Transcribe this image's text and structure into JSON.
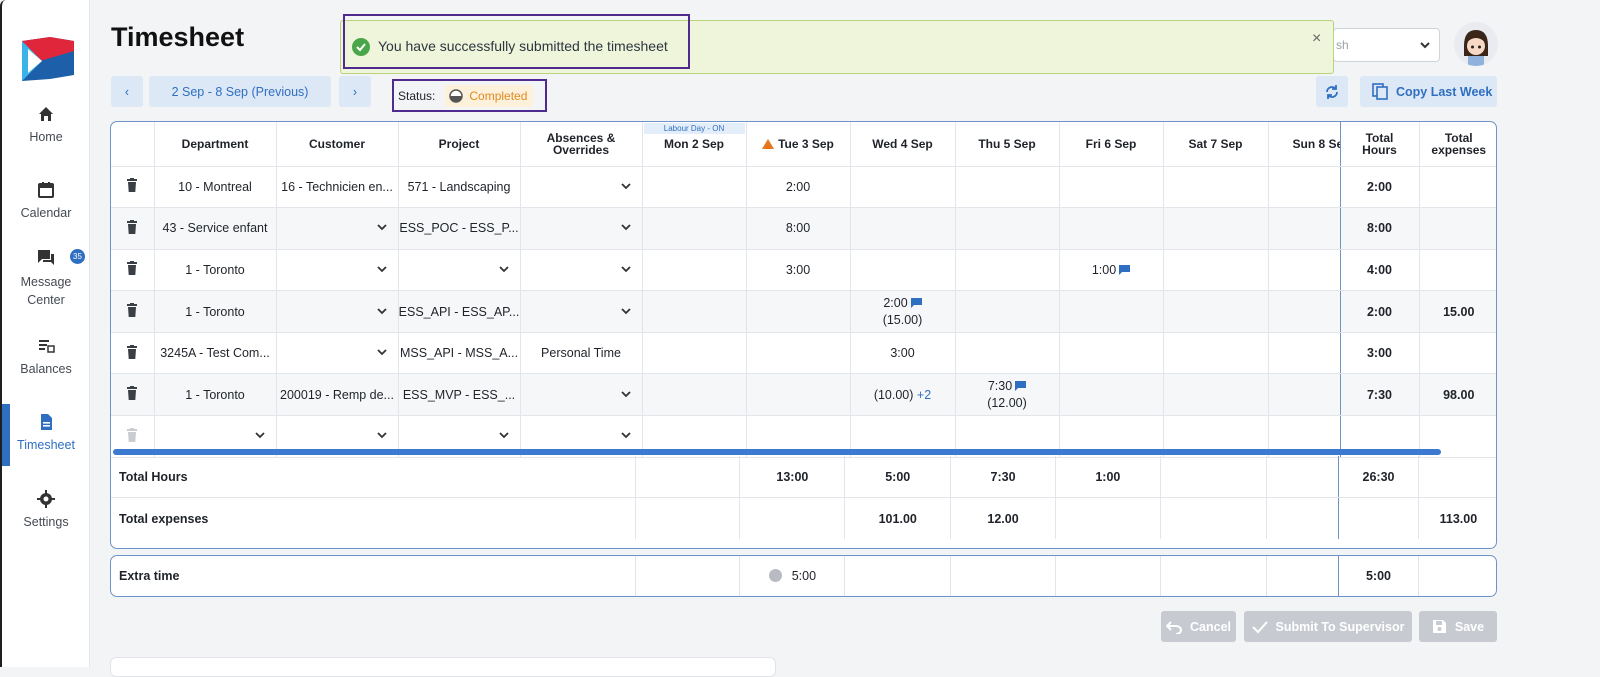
{
  "page": {
    "title": "Timesheet"
  },
  "toast": {
    "message": "You have successfully submitted the timesheet",
    "close": "×"
  },
  "header": {
    "language_placeholder": "sh"
  },
  "sidebar": {
    "items": [
      {
        "label": "Home",
        "icon": "home-icon"
      },
      {
        "label": "Calendar",
        "icon": "calendar-icon"
      },
      {
        "label": "Message Center",
        "icon": "message-icon",
        "badge": "35"
      },
      {
        "label": "Balances",
        "icon": "balances-icon"
      },
      {
        "label": "Timesheet",
        "icon": "timesheet-icon",
        "active": true
      },
      {
        "label": "Settings",
        "icon": "gear-icon"
      }
    ]
  },
  "week": {
    "range": "2 Sep - 8 Sep (Previous)",
    "prev": "‹",
    "next": "›"
  },
  "status": {
    "label": "Status:",
    "value": "Completed"
  },
  "toolbar": {
    "copy_label": "Copy Last Week"
  },
  "columns": {
    "department": "Department",
    "customer": "Customer",
    "project": "Project",
    "absences": "Absences & Overrides",
    "holiday": "Labour Day - ON",
    "days": [
      "Mon 2 Sep",
      "Tue 3 Sep",
      "Wed 4 Sep",
      "Thu 5 Sep",
      "Fri 6 Sep",
      "Sat 7 Sep",
      "Sun 8 Se"
    ],
    "total_hours": "Total Hours",
    "total_expenses": "Total expenses"
  },
  "rows": [
    {
      "department": "10 - Montreal",
      "customer": "16 - Technicien en...",
      "project": "571 - Landscaping",
      "absence": "",
      "days": [
        "",
        "2:00",
        "",
        "",
        "",
        "",
        ""
      ],
      "total_hours": "2:00",
      "total_expenses": ""
    },
    {
      "department": "43 - Service enfant",
      "customer": "",
      "project": "ESS_POC - ESS_P...",
      "absence": "",
      "days": [
        "",
        "8:00",
        "",
        "",
        "",
        "",
        ""
      ],
      "total_hours": "8:00",
      "total_expenses": ""
    },
    {
      "department": "1 - Toronto",
      "customer": "",
      "project": "",
      "absence": "",
      "days": [
        "",
        "3:00",
        "",
        "",
        "1:00",
        "",
        ""
      ],
      "total_hours": "4:00",
      "total_expenses": ""
    },
    {
      "department": "1 - Toronto",
      "customer": "",
      "project": "ESS_API - ESS_AP...",
      "absence": "",
      "days": [
        "",
        "",
        "2:00",
        "",
        "",
        "",
        ""
      ],
      "wed_expense": "(15.00)",
      "total_hours": "2:00",
      "total_expenses": "15.00"
    },
    {
      "department": "3245A - Test Com...",
      "customer": "",
      "project": "MSS_API - MSS_A...",
      "absence": "Personal Time",
      "days": [
        "",
        "",
        "3:00",
        "",
        "",
        "",
        ""
      ],
      "total_hours": "3:00",
      "total_expenses": ""
    },
    {
      "department": "1 - Toronto",
      "customer": "200019 - Remp de...",
      "project": "ESS_MVP - ESS_...",
      "absence": "",
      "days": [
        "",
        "",
        "(10.00)",
        "7:30",
        "",
        "",
        ""
      ],
      "wed_more": "+2",
      "thu_expense": "(12.00)",
      "total_hours": "7:30",
      "total_expenses": "98.00"
    }
  ],
  "totals": {
    "hours_label": "Total Hours",
    "hours": [
      "",
      "13:00",
      "5:00",
      "7:30",
      "1:00",
      "",
      ""
    ],
    "hours_total": "26:30",
    "expenses_label": "Total expenses",
    "expenses": [
      "",
      "",
      "101.00",
      "12.00",
      "",
      "",
      ""
    ],
    "expenses_total": "113.00"
  },
  "extra_time": {
    "label": "Extra time",
    "tue": "5:00",
    "total": "5:00"
  },
  "actions": {
    "cancel": "Cancel",
    "submit": "Submit To Supervisor",
    "save": "Save"
  },
  "colors": {
    "accent": "#2f6fc1",
    "status": "#e08a1e",
    "toast_bg": "#eef5da",
    "highlight": "#4f2a8f"
  }
}
